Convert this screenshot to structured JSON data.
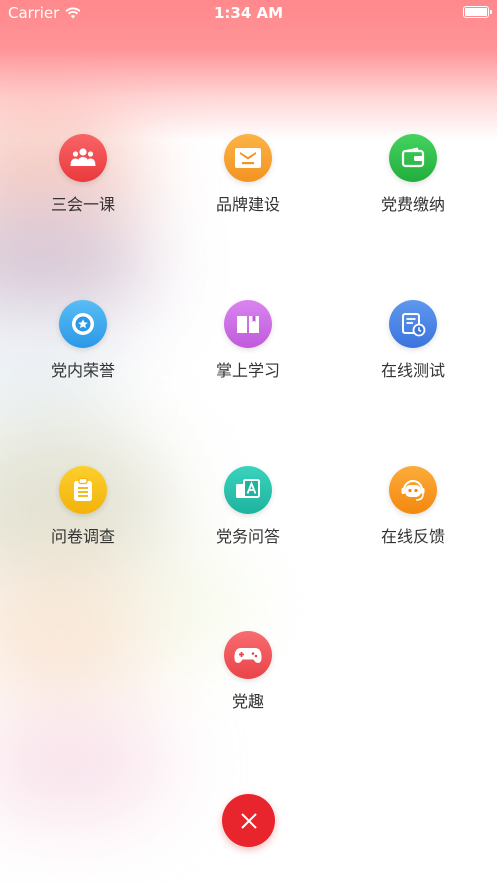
{
  "status_bar": {
    "carrier": "Carrier",
    "time": "1:34 AM"
  },
  "menu": {
    "items": [
      {
        "label": "三会一课",
        "icon": "people-group-icon",
        "color": "#f2494b"
      },
      {
        "label": "品牌建设",
        "icon": "comac-logo-icon",
        "color": "#f7a233"
      },
      {
        "label": "党费缴纳",
        "icon": "wallet-icon",
        "color": "#32c24d"
      },
      {
        "label": "党内荣誉",
        "icon": "medal-star-icon",
        "color": "#3aa6ee"
      },
      {
        "label": "掌上学习",
        "icon": "book-icon",
        "color": "#cc6ee6"
      },
      {
        "label": "在线测试",
        "icon": "document-clock-icon",
        "color": "#4a86e6"
      },
      {
        "label": "问卷调查",
        "icon": "clipboard-icon",
        "color": "#f7c21c"
      },
      {
        "label": "党务问答",
        "icon": "question-answer-icon",
        "color": "#29c3ad"
      },
      {
        "label": "在线反馈",
        "icon": "customer-service-robot-icon",
        "color": "#f79a1f"
      },
      {
        "label": "党趣",
        "icon": "gamepad-icon",
        "color": "#f0555a"
      }
    ]
  },
  "close_button": {
    "icon": "close-icon",
    "color": "#e8252d"
  }
}
